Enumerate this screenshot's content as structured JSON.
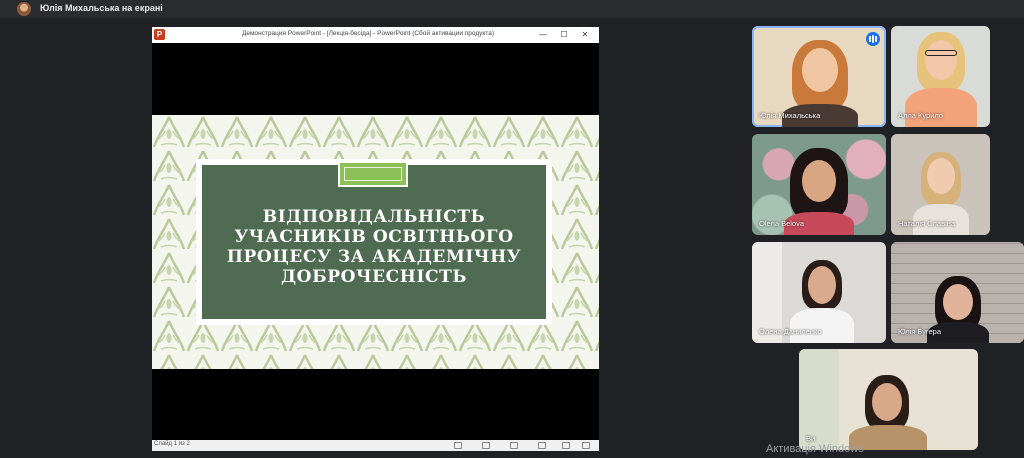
{
  "presenter": {
    "label": "Юлія Михальська на екрані"
  },
  "ppt": {
    "window_title": "Демонстрация PowerPoint - [Лекція-бесіда] - PowerPoint (Сбой активации продукта)",
    "logo": "P",
    "min_icon": "—",
    "max_icon": "☐",
    "close_icon": "✕",
    "status_text": "Слайд 1 из 2",
    "slide_title": "Відповідальність учасників освітнього процесу за академічну доброчесність"
  },
  "participants": [
    {
      "name": "Юлія Михальська",
      "speaking": true
    },
    {
      "name": "Алла Курило"
    },
    {
      "name": "Olena Belova"
    },
    {
      "name": "Наталія Славіна"
    },
    {
      "name": "Олена Даниленко"
    },
    {
      "name": "Юлія Бугера"
    },
    {
      "name": "Ви"
    }
  ],
  "watermark": "Активація Windows",
  "colors": {
    "slide_panel": "#4f6b52",
    "slide_pattern": "#b7c99a",
    "accent": "#8cbf58",
    "speaking": "#1a73e8"
  }
}
